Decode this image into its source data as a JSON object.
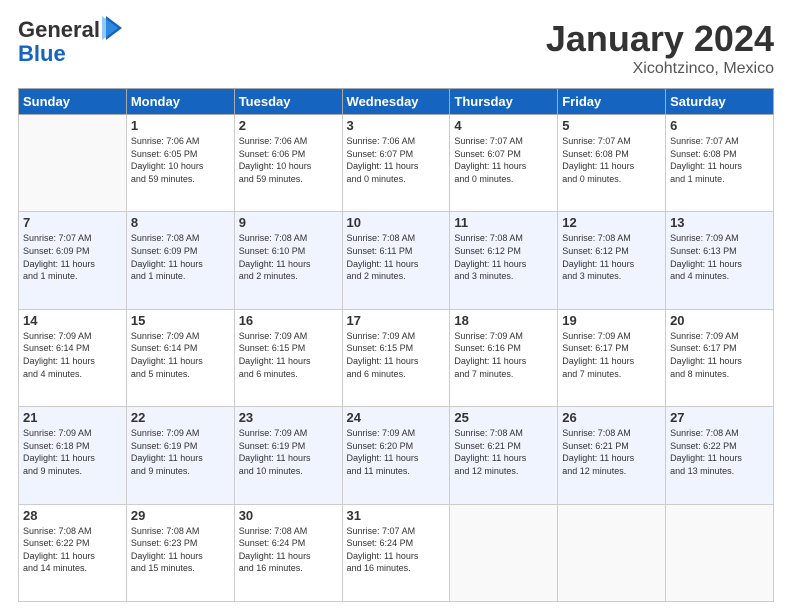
{
  "header": {
    "logo": {
      "line1": "General",
      "line2": "Blue"
    },
    "title": "January 2024",
    "location": "Xicohtzinco, Mexico"
  },
  "days_of_week": [
    "Sunday",
    "Monday",
    "Tuesday",
    "Wednesday",
    "Thursday",
    "Friday",
    "Saturday"
  ],
  "weeks": [
    [
      {
        "day": "",
        "sunrise": "",
        "sunset": "",
        "daylight": ""
      },
      {
        "day": "1",
        "sunrise": "7:06 AM",
        "sunset": "6:05 PM",
        "daylight": "10 hours and 59 minutes."
      },
      {
        "day": "2",
        "sunrise": "7:06 AM",
        "sunset": "6:06 PM",
        "daylight": "10 hours and 59 minutes."
      },
      {
        "day": "3",
        "sunrise": "7:06 AM",
        "sunset": "6:07 PM",
        "daylight": "11 hours and 0 minutes."
      },
      {
        "day": "4",
        "sunrise": "7:07 AM",
        "sunset": "6:07 PM",
        "daylight": "11 hours and 0 minutes."
      },
      {
        "day": "5",
        "sunrise": "7:07 AM",
        "sunset": "6:08 PM",
        "daylight": "11 hours and 0 minutes."
      },
      {
        "day": "6",
        "sunrise": "7:07 AM",
        "sunset": "6:08 PM",
        "daylight": "11 hours and 1 minute."
      }
    ],
    [
      {
        "day": "7",
        "sunrise": "7:07 AM",
        "sunset": "6:09 PM",
        "daylight": "11 hours and 1 minute."
      },
      {
        "day": "8",
        "sunrise": "7:08 AM",
        "sunset": "6:09 PM",
        "daylight": "11 hours and 1 minute."
      },
      {
        "day": "9",
        "sunrise": "7:08 AM",
        "sunset": "6:10 PM",
        "daylight": "11 hours and 2 minutes."
      },
      {
        "day": "10",
        "sunrise": "7:08 AM",
        "sunset": "6:11 PM",
        "daylight": "11 hours and 2 minutes."
      },
      {
        "day": "11",
        "sunrise": "7:08 AM",
        "sunset": "6:12 PM",
        "daylight": "11 hours and 3 minutes."
      },
      {
        "day": "12",
        "sunrise": "7:08 AM",
        "sunset": "6:12 PM",
        "daylight": "11 hours and 3 minutes."
      },
      {
        "day": "13",
        "sunrise": "7:09 AM",
        "sunset": "6:13 PM",
        "daylight": "11 hours and 4 minutes."
      }
    ],
    [
      {
        "day": "14",
        "sunrise": "7:09 AM",
        "sunset": "6:14 PM",
        "daylight": "11 hours and 4 minutes."
      },
      {
        "day": "15",
        "sunrise": "7:09 AM",
        "sunset": "6:14 PM",
        "daylight": "11 hours and 5 minutes."
      },
      {
        "day": "16",
        "sunrise": "7:09 AM",
        "sunset": "6:15 PM",
        "daylight": "11 hours and 6 minutes."
      },
      {
        "day": "17",
        "sunrise": "7:09 AM",
        "sunset": "6:15 PM",
        "daylight": "11 hours and 6 minutes."
      },
      {
        "day": "18",
        "sunrise": "7:09 AM",
        "sunset": "6:16 PM",
        "daylight": "11 hours and 7 minutes."
      },
      {
        "day": "19",
        "sunrise": "7:09 AM",
        "sunset": "6:17 PM",
        "daylight": "11 hours and 7 minutes."
      },
      {
        "day": "20",
        "sunrise": "7:09 AM",
        "sunset": "6:17 PM",
        "daylight": "11 hours and 8 minutes."
      }
    ],
    [
      {
        "day": "21",
        "sunrise": "7:09 AM",
        "sunset": "6:18 PM",
        "daylight": "11 hours and 9 minutes."
      },
      {
        "day": "22",
        "sunrise": "7:09 AM",
        "sunset": "6:19 PM",
        "daylight": "11 hours and 9 minutes."
      },
      {
        "day": "23",
        "sunrise": "7:09 AM",
        "sunset": "6:19 PM",
        "daylight": "11 hours and 10 minutes."
      },
      {
        "day": "24",
        "sunrise": "7:09 AM",
        "sunset": "6:20 PM",
        "daylight": "11 hours and 11 minutes."
      },
      {
        "day": "25",
        "sunrise": "7:08 AM",
        "sunset": "6:21 PM",
        "daylight": "11 hours and 12 minutes."
      },
      {
        "day": "26",
        "sunrise": "7:08 AM",
        "sunset": "6:21 PM",
        "daylight": "11 hours and 12 minutes."
      },
      {
        "day": "27",
        "sunrise": "7:08 AM",
        "sunset": "6:22 PM",
        "daylight": "11 hours and 13 minutes."
      }
    ],
    [
      {
        "day": "28",
        "sunrise": "7:08 AM",
        "sunset": "6:22 PM",
        "daylight": "11 hours and 14 minutes."
      },
      {
        "day": "29",
        "sunrise": "7:08 AM",
        "sunset": "6:23 PM",
        "daylight": "11 hours and 15 minutes."
      },
      {
        "day": "30",
        "sunrise": "7:08 AM",
        "sunset": "6:24 PM",
        "daylight": "11 hours and 16 minutes."
      },
      {
        "day": "31",
        "sunrise": "7:07 AM",
        "sunset": "6:24 PM",
        "daylight": "11 hours and 16 minutes."
      },
      {
        "day": "",
        "sunrise": "",
        "sunset": "",
        "daylight": ""
      },
      {
        "day": "",
        "sunrise": "",
        "sunset": "",
        "daylight": ""
      },
      {
        "day": "",
        "sunrise": "",
        "sunset": "",
        "daylight": ""
      }
    ]
  ]
}
